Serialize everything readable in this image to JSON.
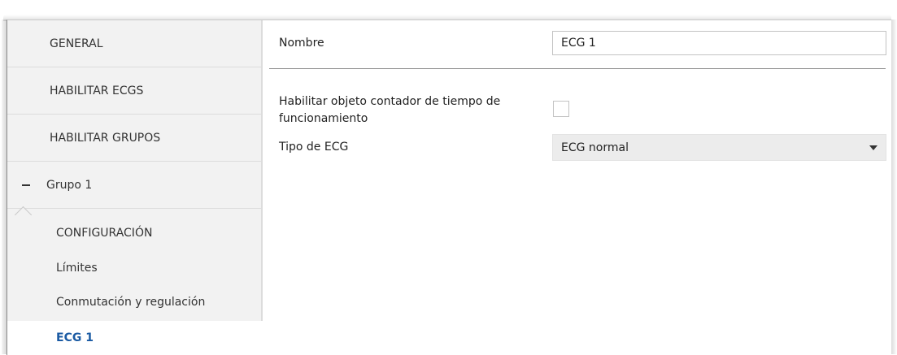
{
  "sidebar": {
    "items": [
      {
        "label": "GENERAL"
      },
      {
        "label": "HABILITAR ECGS"
      },
      {
        "label": "HABILITAR GRUPOS"
      }
    ],
    "group": {
      "label": "Grupo 1",
      "toggle_icon": "minus-icon",
      "expanded": true,
      "subitems": [
        {
          "label": "CONFIGURACIÓN"
        },
        {
          "label": "Límites"
        },
        {
          "label": "Conmutación y regulación"
        },
        {
          "label": "ECG 1",
          "active": true
        }
      ]
    }
  },
  "main": {
    "nombre": {
      "label": "Nombre",
      "value": "ECG 1"
    },
    "contador": {
      "label_line1": "Habilitar objeto contador de tiempo de",
      "label_line2": "funcionamiento",
      "checked": false
    },
    "tipo_ecg": {
      "label": "Tipo de ECG",
      "value": "ECG normal",
      "icon": "chevron-down-icon"
    }
  },
  "colors": {
    "sidebar_bg": "#f2f2f2",
    "active_text": "#1a5aa3",
    "select_bg": "#ececec"
  }
}
